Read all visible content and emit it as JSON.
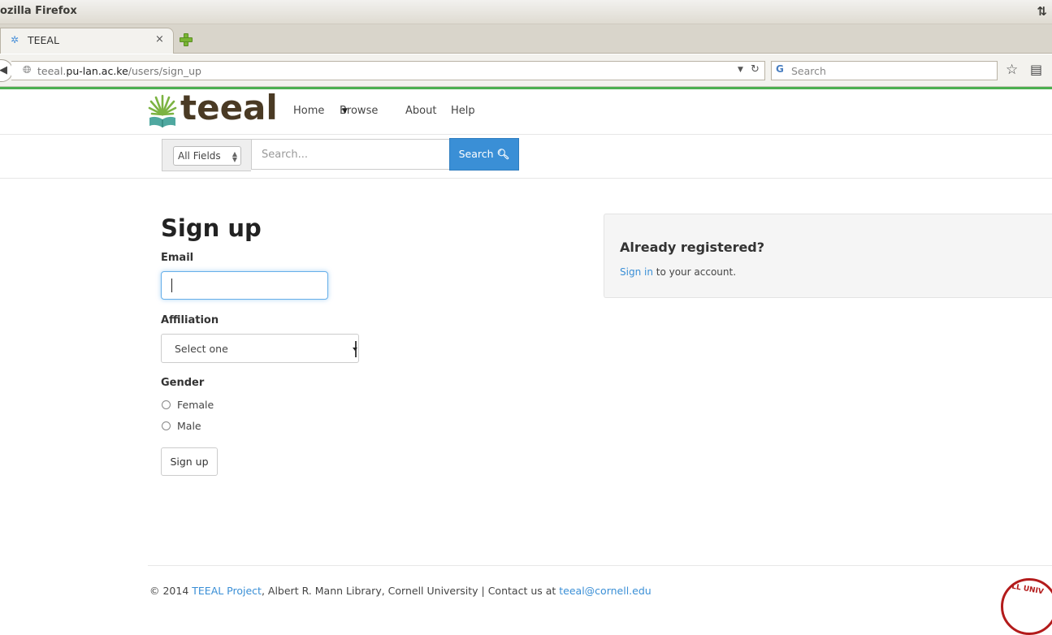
{
  "window": {
    "title": "ozilla Firefox"
  },
  "tab": {
    "title": "TEEAL",
    "close": "×"
  },
  "address": {
    "domain_prefix": "teeal.",
    "domain": "pu-lan.ac.ke",
    "path": "/users/sign_up"
  },
  "browser_search": {
    "placeholder": "Search"
  },
  "site": {
    "logo_text": "teeal",
    "nav": {
      "home": "Home",
      "browse": "Browse",
      "about": "About",
      "help": "Help"
    },
    "search": {
      "field_select": "All Fields",
      "placeholder": "Search...",
      "button": "Search"
    }
  },
  "form": {
    "heading": "Sign up",
    "email_label": "Email",
    "affiliation_label": "Affiliation",
    "affiliation_selected": "Select one",
    "gender_label": "Gender",
    "gender_options": [
      "Female",
      "Male"
    ],
    "submit": "Sign up"
  },
  "panel": {
    "title": "Already registered?",
    "link": "Sign in",
    "text": " to your account."
  },
  "footer": {
    "copyright": "© 2014 ",
    "project_link": "TEEAL Project",
    "middle": ", Albert R. Mann Library, Cornell University | Contact us at ",
    "email_link": "teeal@cornell.edu",
    "seal_text": "LL UNIV"
  },
  "colors": {
    "accent": "#3a8fd6",
    "logo": "#4a3a24",
    "loadbar": "#4caf50"
  }
}
